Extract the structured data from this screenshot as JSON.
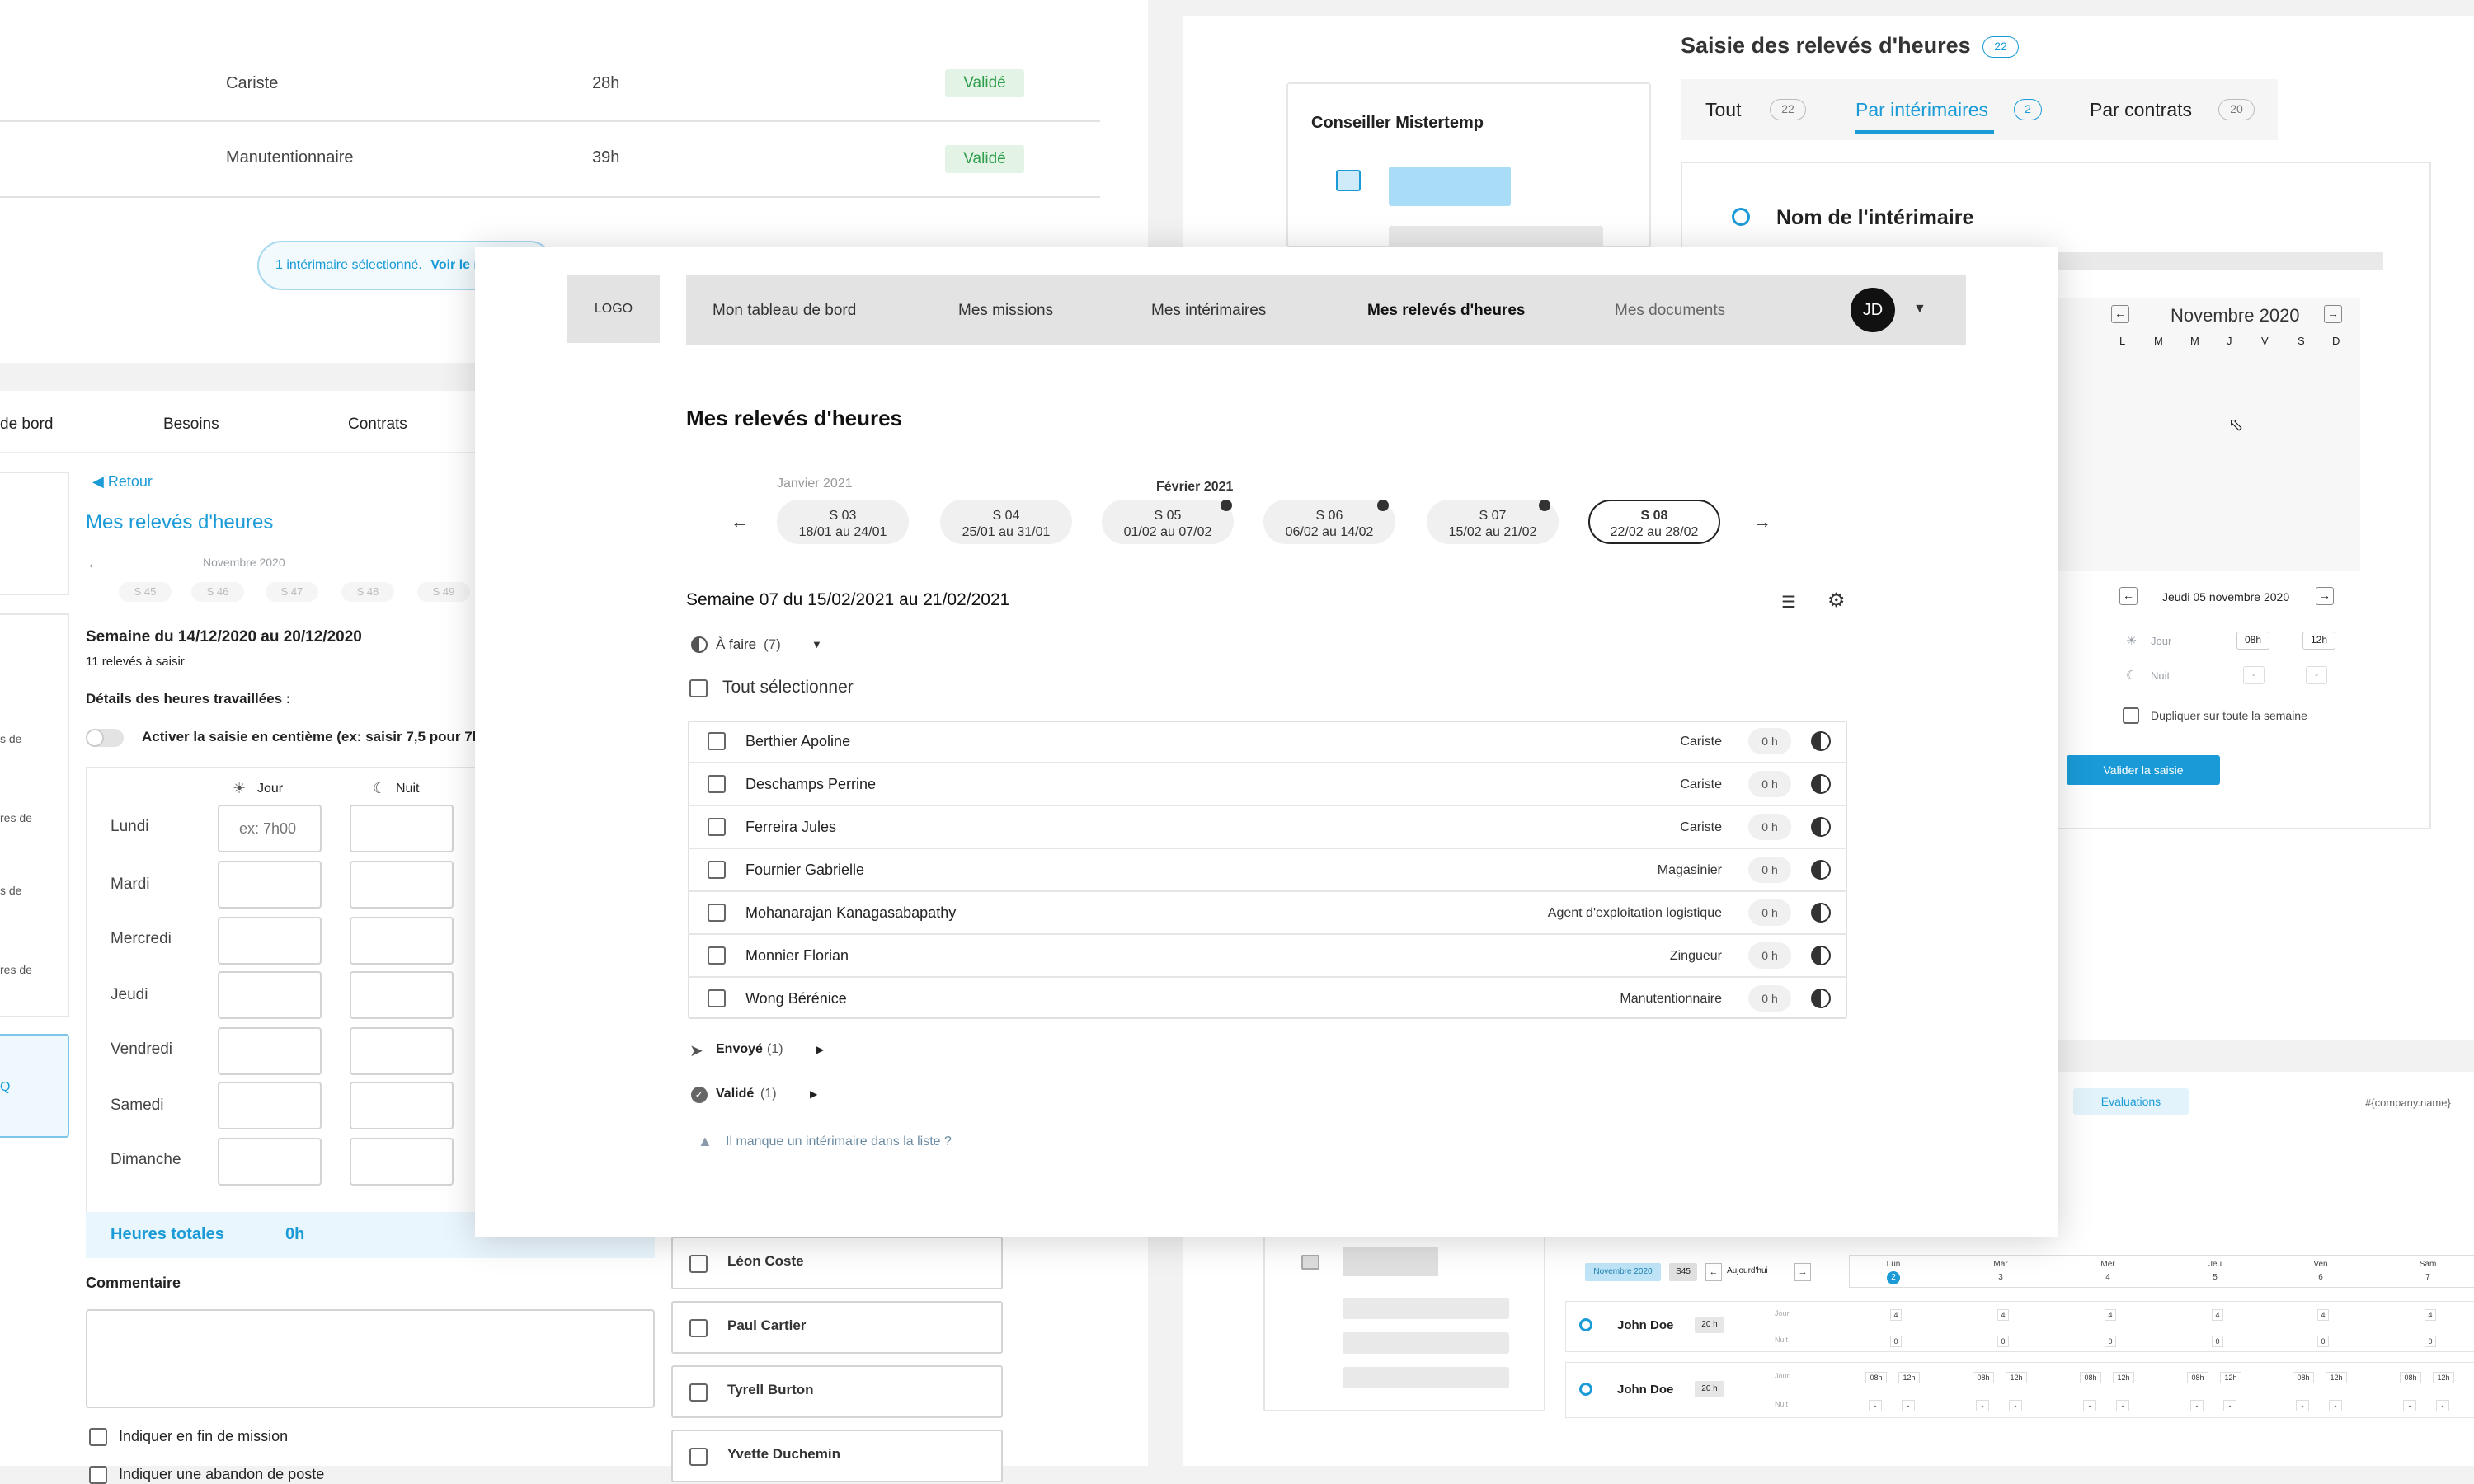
{
  "bg_top_left": {
    "rows": [
      {
        "role": "Cariste",
        "hours": "28h",
        "status": "Validé"
      },
      {
        "role": "Manutentionnaire",
        "hours": "39h",
        "status": "Validé"
      }
    ],
    "selection_notice": "1 intérimaire sélectionné.",
    "selection_link": "Voir le re"
  },
  "bg_left": {
    "tabs": [
      "de bord",
      "Besoins",
      "Contrats"
    ],
    "back": "Retour",
    "title": "Mes relevés d'heures",
    "month": "Novembre 2020",
    "weeks": [
      "S 45",
      "S 46",
      "S 47",
      "S 48",
      "S 49"
    ],
    "week_title": "Semaine du 14/12/2020 au 20/12/2020",
    "count_text": "11  relevés à saisir",
    "details_label": "Détails des heures travaillées :",
    "toggle_label": "Activer la saisie en centième (ex: saisir 7,5 pour 7h30)",
    "col_day": "Jour",
    "col_night": "Nuit",
    "placeholder": "ex: 7h00",
    "days": [
      "Lundi",
      "Mardi",
      "Mercredi",
      "Jeudi",
      "Vendredi",
      "Samedi",
      "Dimanche"
    ],
    "total_label": "Heures totales",
    "total_value": "0h",
    "comment_label": "Commentaire",
    "check_end_mission": "Indiquer en fin de mission",
    "check_abandon": "Indiquer une abandon de poste",
    "side_frag": [
      "s de",
      "res de",
      "s de",
      "res de"
    ],
    "blue_frag": "Q"
  },
  "bg_bottom_list": [
    "Léon Coste",
    "Paul Cartier",
    "Tyrell Burton",
    "Yvette Duchemin"
  ],
  "bg_right": {
    "title": "Saisie des relevés d'heures",
    "title_count": "22",
    "card_title": "Conseiller Mistertemp",
    "tabs": [
      {
        "label": "Tout",
        "count": "22"
      },
      {
        "label": "Par intérimaires",
        "count": "2"
      },
      {
        "label": "Par contrats",
        "count": "20"
      }
    ],
    "name_label": "Nom de l'intérimaire",
    "calendar": {
      "month": "Novembre 2020",
      "weekdays": [
        "L",
        "M",
        "M",
        "J",
        "V",
        "S",
        "D"
      ]
    },
    "day_label": "Jeudi 05 novembre 2020",
    "jour": "Jour",
    "nuit": "Nuit",
    "start": "08h",
    "end": "12h",
    "dash": "-",
    "duplicate": "Dupliquer sur toute la semaine",
    "validate": "Valider la saisie",
    "evaluations": "Evaluations",
    "company": "#{company.name}",
    "planning": {
      "month_chip": "Novembre 2020",
      "week_chip": "S45",
      "today": "Aujourd'hui",
      "days": [
        {
          "name": "Lun",
          "num": "2"
        },
        {
          "name": "Mar",
          "num": "3"
        },
        {
          "name": "Mer",
          "num": "4"
        },
        {
          "name": "Jeu",
          "num": "5"
        },
        {
          "name": "Ven",
          "num": "6"
        },
        {
          "name": "Sam",
          "num": "7"
        }
      ],
      "people": [
        {
          "name": "John Doe",
          "hours": "20 h"
        },
        {
          "name": "John Doe",
          "hours": "20 h"
        }
      ],
      "val4": "4",
      "val0": "0"
    }
  },
  "main": {
    "logo": "LOGO",
    "nav": [
      "Mon tableau de bord",
      "Mes missions",
      "Mes intérimaires",
      "Mes relevés d'heures",
      "Mes documents"
    ],
    "avatar": "JD",
    "page_title": "Mes relevés d'heures",
    "month_jan": "Janvier 2021",
    "month_feb": "Février 2021",
    "weeks": [
      {
        "label": "S 03",
        "range": "18/01 au 24/01"
      },
      {
        "label": "S 04",
        "range": "25/01 au 31/01"
      },
      {
        "label": "S 05",
        "range": "01/02 au 07/02"
      },
      {
        "label": "S 06",
        "range": "06/02 au 14/02"
      },
      {
        "label": "S 07",
        "range": "15/02 au 21/02"
      },
      {
        "label": "S 08",
        "range": "22/02 au 28/02"
      }
    ],
    "week_title": "Semaine 07 du 15/02/2021 au 21/02/2021",
    "todo_label": "À faire",
    "todo_count": "(7)",
    "select_all": "Tout sélectionner",
    "rows": [
      {
        "name": "Berthier Apoline",
        "role": "Cariste",
        "hours": "0 h"
      },
      {
        "name": "Deschamps Perrine",
        "role": "Cariste",
        "hours": "0 h"
      },
      {
        "name": "Ferreira Jules",
        "role": "Cariste",
        "hours": "0 h"
      },
      {
        "name": "Fournier Gabrielle",
        "role": "Magasinier",
        "hours": "0 h"
      },
      {
        "name": "Mohanarajan Kanagasabapathy",
        "role": "Agent d'exploitation logistique",
        "hours": "0 h"
      },
      {
        "name": "Monnier Florian",
        "role": "Zingueur",
        "hours": "0 h"
      },
      {
        "name": "Wong Bérénice",
        "role": "Manutentionnaire",
        "hours": "0 h"
      }
    ],
    "sent_label": "Envoyé",
    "sent_count": "(1)",
    "valid_label": "Validé",
    "valid_count": "(1)",
    "missing": "Il manque un intérimaire dans la liste ?"
  },
  "colors": {
    "accent": "#1a9bd7",
    "success_bg": "#e3f4e6",
    "success_text": "#2e9e4a"
  }
}
